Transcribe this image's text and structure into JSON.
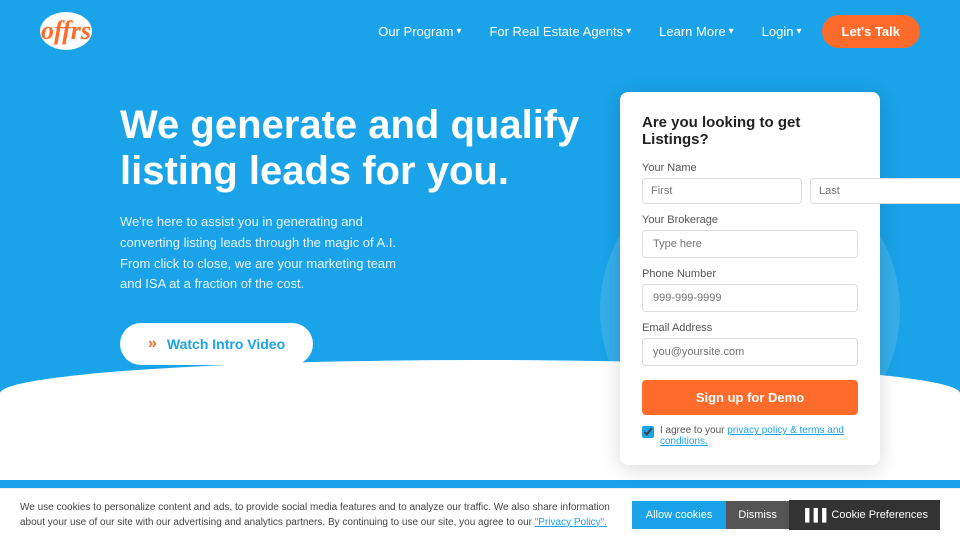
{
  "nav": {
    "logo": "offrs",
    "links": [
      {
        "label": "Our Program",
        "id": "our-program"
      },
      {
        "label": "For Real Estate Agents",
        "id": "real-estate-agents"
      },
      {
        "label": "Learn More",
        "id": "learn-more"
      },
      {
        "label": "Login",
        "id": "login"
      }
    ],
    "cta_label": "Let's Talk"
  },
  "hero": {
    "title": "We generate and qualify listing leads for you.",
    "description": "We're here to assist you in generating and converting listing leads through the magic of A.I. From click to close, we are your marketing team and ISA at a fraction of the cost.",
    "watch_btn": "Watch Intro Video"
  },
  "form": {
    "title": "Are you looking to get Listings?",
    "name_label": "Your Name",
    "first_placeholder": "First",
    "last_placeholder": "Last",
    "brokerage_label": "Your Brokerage",
    "brokerage_placeholder": "Type here",
    "phone_label": "Phone Number",
    "phone_placeholder": "999-999-9999",
    "email_label": "Email Address",
    "email_placeholder": "you@yoursite.com",
    "submit_label": "Sign up for Demo",
    "agree_text": "I agree to your ",
    "agree_link": "privacy policy & terms and conditions."
  },
  "cookie": {
    "text": "We use cookies to personalize content and ads, to provide social media features and to analyze our traffic. We also share information about your use of our site with our advertising and analytics partners. By continuing to use our site, you agree to our ",
    "link_text": "\"Privacy Policy\".",
    "allow_label": "Allow cookies",
    "dismiss_label": "Dismiss",
    "preferences_label": "Cookie Preferences"
  },
  "colors": {
    "blue": "#1aa3e8",
    "orange": "#ff6b2b",
    "white": "#ffffff"
  }
}
